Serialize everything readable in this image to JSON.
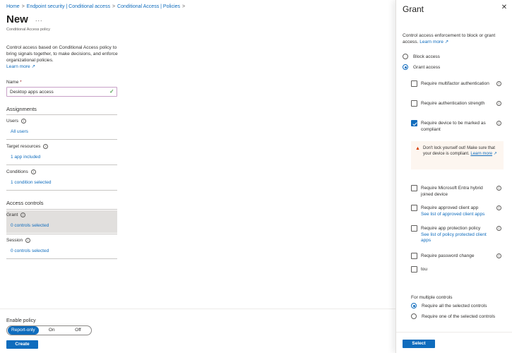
{
  "breadcrumb": [
    "Home",
    "Endpoint security | Conditional access",
    "Conditional Access | Policies"
  ],
  "page": {
    "title": "New",
    "more": "...",
    "subtitle": "Conditional Access policy",
    "intro": "Control access based on Conditional Access policy to bring signals together, to make decisions, and enforce organizational policies.",
    "learn_more": "Learn more"
  },
  "name_field": {
    "label": "Name",
    "required": "*",
    "value": "Desktop apps access"
  },
  "assignments": {
    "heading": "Assignments",
    "users_label": "Users",
    "users_value": "All users",
    "target_label": "Target resources",
    "target_value": "1 app included",
    "conditions_label": "Conditions",
    "conditions_value": "1 condition selected"
  },
  "access_controls": {
    "heading": "Access controls",
    "grant_label": "Grant",
    "grant_value": "0 controls selected",
    "session_label": "Session",
    "session_value": "0 controls selected"
  },
  "footer": {
    "enable_label": "Enable policy",
    "toggle": [
      "Report-only",
      "On",
      "Off"
    ],
    "toggle_selected": "Report-only",
    "create": "Create"
  },
  "panel": {
    "title": "Grant",
    "close": "✕",
    "intro": "Control access enforcement to block or grant access.",
    "learn_more": "Learn more",
    "block": "Block access",
    "grant": "Grant access",
    "grant_selected": true,
    "controls": [
      {
        "label": "Require multifactor authentication",
        "checked": false
      },
      {
        "label": "Require authentication strength",
        "checked": false
      },
      {
        "label": "Require device to be marked as compliant",
        "checked": true
      },
      {
        "label": "Require Microsoft Entra hybrid joined device",
        "checked": false
      },
      {
        "label": "Require approved client app",
        "link": "See list of approved client apps",
        "checked": false
      },
      {
        "label": "Require app protection policy",
        "link": "See list of policy protected client apps",
        "checked": false
      },
      {
        "label": "Require password change",
        "checked": false
      },
      {
        "label": "tou",
        "checked": false
      }
    ],
    "warning_text": "Don't lock yourself out! Make sure that your device is compliant.",
    "warning_link": "Learn more",
    "multi_label": "For multiple controls",
    "multi_all": "Require all the selected controls",
    "multi_one": "Require one of the selected controls",
    "multi_selected": "all",
    "select": "Select"
  },
  "colors": {
    "accent": "#0f6cbd",
    "success": "#107c10",
    "warning": "#d83b01"
  }
}
